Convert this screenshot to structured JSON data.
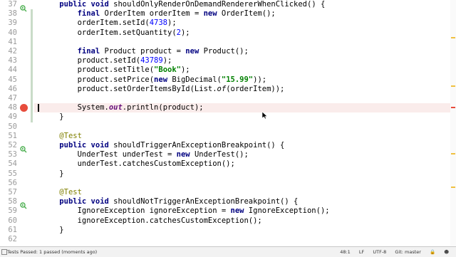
{
  "editor": {
    "lines": [
      {
        "n": "37",
        "html": "    <span class=\"kw\">public void</span> shouldOnlyRenderOnDemandRendererWhenClicked() {"
      },
      {
        "n": "38",
        "html": "        <span class=\"kw\">final</span> OrderItem orderItem = <span class=\"kw\">new</span> OrderItem();"
      },
      {
        "n": "39",
        "html": "        orderItem.setId(<span class=\"num\">4738</span>);"
      },
      {
        "n": "40",
        "html": "        orderItem.setQuantity(<span class=\"num\">2</span>);"
      },
      {
        "n": "41",
        "html": ""
      },
      {
        "n": "42",
        "html": "        <span class=\"kw\">final</span> Product product = <span class=\"kw\">new</span> Product();"
      },
      {
        "n": "43",
        "html": "        product.setId(<span class=\"num\">43789</span>);"
      },
      {
        "n": "44",
        "html": "        product.setTitle(<span class=\"str\">\"Book\"</span>);"
      },
      {
        "n": "45",
        "html": "        product.setPrice(<span class=\"kw\">new</span> BigDecimal(<span class=\"str\">\"15.99\"</span>));"
      },
      {
        "n": "46",
        "html": "        product.setOrderItemsById(List.<span class=\"static\">of</span>(orderItem));"
      },
      {
        "n": "47",
        "html": ""
      },
      {
        "n": "48",
        "html": "        System.<span class=\"field\">out</span>.println(product);"
      },
      {
        "n": "49",
        "html": "    }"
      },
      {
        "n": "50",
        "html": ""
      },
      {
        "n": "51",
        "html": "    <span class=\"ann\">@Test</span>"
      },
      {
        "n": "52",
        "html": "    <span class=\"kw\">public void</span> shouldTriggerAnExceptionBreakpoint() {"
      },
      {
        "n": "53",
        "html": "        UnderTest underTest = <span class=\"kw\">new</span> UnderTest();"
      },
      {
        "n": "54",
        "html": "        underTest.catchesCustomException();"
      },
      {
        "n": "55",
        "html": "    }"
      },
      {
        "n": "56",
        "html": ""
      },
      {
        "n": "57",
        "html": "    <span class=\"ann\">@Test</span>"
      },
      {
        "n": "58",
        "html": "    <span class=\"kw\">public void</span> shouldNotTriggerAnExceptionBreakpoint() {"
      },
      {
        "n": "59",
        "html": "        IgnoreException ignoreException = <span class=\"kw\">new</span> IgnoreException();"
      },
      {
        "n": "60",
        "html": "        ignoreException.catchesCustomException();"
      },
      {
        "n": "61",
        "html": "    }"
      },
      {
        "n": "62",
        "html": ""
      }
    ],
    "breakpoint_line": "48",
    "run_icon_lines": [
      "37",
      "52",
      "58"
    ]
  },
  "statusbar": {
    "message": "Tests Passed: 1 passed (moments ago)",
    "position": "48:1",
    "line_separator": "LF",
    "encoding": "UTF-8",
    "vcs": "Git: master",
    "icon_lock": "lock-icon",
    "icon_person": "hector-icon"
  },
  "colors": {
    "breakpoint": "#e74c3c",
    "current_line": "#faeceb",
    "run_icon": "#4caf50"
  }
}
